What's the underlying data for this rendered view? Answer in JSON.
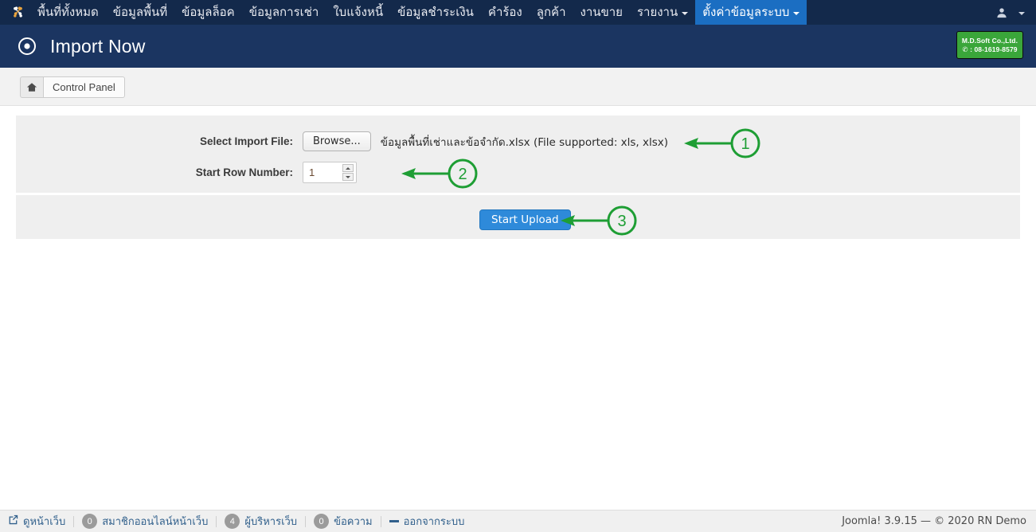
{
  "navbar": {
    "logo_icon": "joomla-logo-icon",
    "items": [
      {
        "label": "พื้นที่ทั้งหมด",
        "active": false,
        "has_caret": false
      },
      {
        "label": "ข้อมูลพื้นที่",
        "active": false,
        "has_caret": false
      },
      {
        "label": "ข้อมูลล็อค",
        "active": false,
        "has_caret": false
      },
      {
        "label": "ข้อมูลการเช่า",
        "active": false,
        "has_caret": false
      },
      {
        "label": "ใบแจ้งหนี้",
        "active": false,
        "has_caret": false
      },
      {
        "label": "ข้อมูลชำระเงิน",
        "active": false,
        "has_caret": false
      },
      {
        "label": "คำร้อง",
        "active": false,
        "has_caret": false
      },
      {
        "label": "ลูกค้า",
        "active": false,
        "has_caret": false
      },
      {
        "label": "งานขาย",
        "active": false,
        "has_caret": false
      },
      {
        "label": "รายงาน",
        "active": false,
        "has_caret": true
      },
      {
        "label": "ตั้งค่าข้อมูลระบบ",
        "active": true,
        "has_caret": true
      }
    ],
    "user_icon": "user-icon",
    "active_color": "#1b6ec2",
    "background": "#13294b"
  },
  "header": {
    "icon": "target-circle-icon",
    "title": "Import Now",
    "background": "#1b3561"
  },
  "brand_badge": {
    "line1": "M.D.Soft Co.,Ltd.",
    "line2": "✆ : 08-1619-8579",
    "color": "#3aa63a"
  },
  "toolbar": {
    "home_icon": "home-icon",
    "control_panel_label": "Control Panel"
  },
  "form": {
    "file_field": {
      "label": "Select Import File:",
      "browse_button": "Browse...",
      "selected_file_text": "ข้อมูลพื้นที่เช่าและข้อจำกัด.xlsx (File supported: xls, xlsx)"
    },
    "start_row": {
      "label": "Start Row Number:",
      "value": "1",
      "placeholder": ""
    },
    "upload_button": "Start Upload"
  },
  "annotations": [
    {
      "number": "1",
      "target": "selected-file-text"
    },
    {
      "number": "2",
      "target": "start-row-input"
    },
    {
      "number": "3",
      "target": "start-upload-button"
    }
  ],
  "annotation_color": "#1e9e34",
  "footer": {
    "items": [
      {
        "icon": "external-link-icon",
        "badge": null,
        "label": "ดูหน้าเว็บ"
      },
      {
        "icon": null,
        "badge": "0",
        "label": "สมาชิกออนไลน์หน้าเว็บ"
      },
      {
        "icon": null,
        "badge": "4",
        "label": "ผู้บริหารเว็บ"
      },
      {
        "icon": null,
        "badge": "0",
        "label": "ข้อความ"
      },
      {
        "icon": "minus-icon",
        "badge": null,
        "label": "ออกจากระบบ"
      }
    ],
    "copyright": "Joomla! 3.9.15  —  © 2020 RN Demo"
  }
}
